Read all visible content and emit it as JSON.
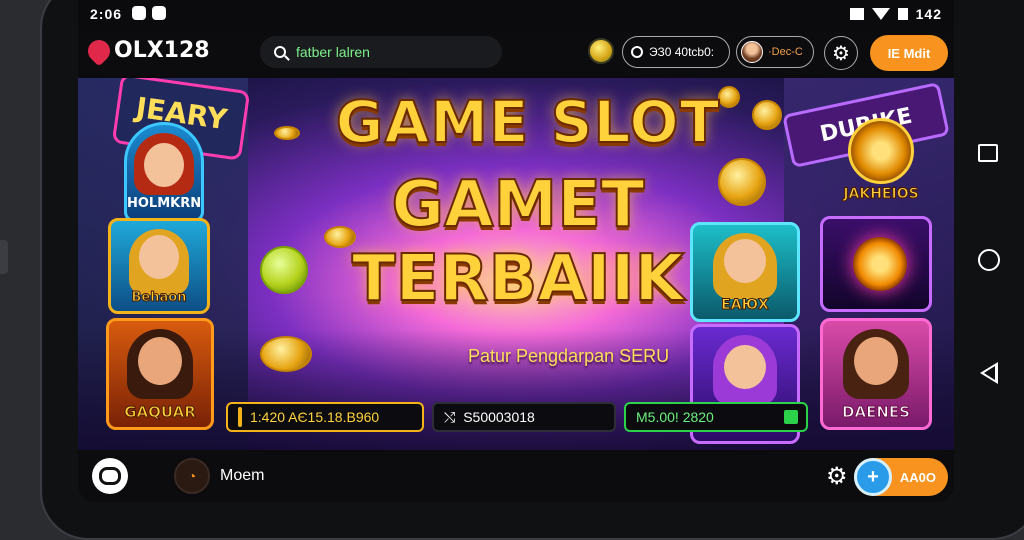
{
  "status_bar": {
    "time": "2:06",
    "right_text": "142"
  },
  "header": {
    "logo_text": "OLX128",
    "search_value": "fatber lalren",
    "balance": "ЭЗ0 40tcb0:",
    "username": "·Dec-C",
    "login_label": "IЕ Mdit"
  },
  "banner": {
    "sign_left": "JEARY",
    "sign_right": "DUBIKE",
    "title_line1": "GAME SLOT",
    "title_line2": "GAMET",
    "title_line3": "TERBAIIK",
    "subtitle": "Patur Pengdarpan SERU",
    "cards": [
      {
        "label": "HOLMKRN"
      },
      {
        "label": "Behaon"
      },
      {
        "label": "GAQUAR"
      },
      {
        "label": "ЕАЮХ"
      },
      {
        "label": ""
      },
      {
        "label": ""
      },
      {
        "label": "DAENES"
      }
    ],
    "jackpot_label": "JAKHEIOS",
    "stats": [
      {
        "text": "1:420 AЄ15.18.B960"
      },
      {
        "text": "S50003018"
      },
      {
        "text": "M5.00! 2820"
      }
    ]
  },
  "bottom_bar": {
    "menu_label": "Moem",
    "action_label": "AA0O"
  },
  "colors": {
    "accent_orange": "#f7931e",
    "logo_red": "#e0284a",
    "search_text": "#7cf08a",
    "stat_green": "#2bd24a",
    "title_gold": "#ffd23c"
  },
  "icons": [
    "search-icon",
    "coin-icon",
    "gear-icon",
    "chat-icon",
    "menu-icon",
    "plus-icon",
    "wifi-icon",
    "battery-icon"
  ]
}
